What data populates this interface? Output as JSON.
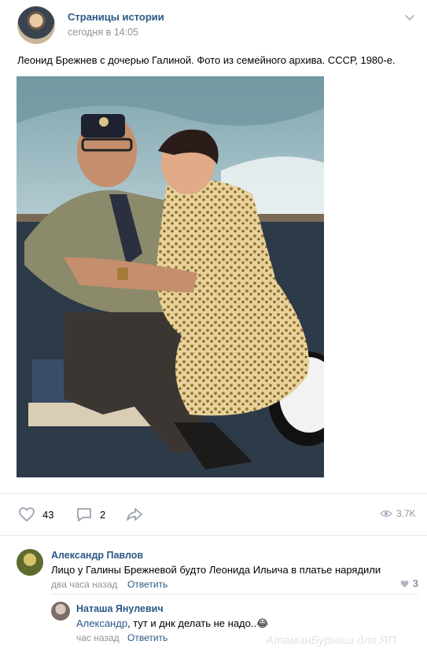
{
  "post": {
    "author": "Страницы истории",
    "date": "сегодня в 14:05",
    "text": "Леонид Брежнев с дочерью Галиной. Фото из семейного архива. СССР, 1980-е.",
    "likes": "43",
    "comments": "2",
    "views": "3.7K"
  },
  "icons": {
    "menu": "chevron-down-icon",
    "like": "heart-icon",
    "comment": "comment-icon",
    "share": "share-arrow-icon",
    "views": "eye-icon",
    "comment_like": "heart-icon"
  },
  "comments": [
    {
      "author": "Александр Павлов",
      "text": "Лицо у Галины Брежневой будто Леонида Ильича в платье нарядили",
      "time": "два часа назад",
      "reply_label": "Ответить",
      "likes": "3"
    },
    {
      "author": "Наташа Янулевич",
      "reply_to": "Александр",
      "text": ", тут и днк делать не надо..",
      "emoji": "😂",
      "time": "час назад",
      "reply_label": "Ответить"
    }
  ],
  "watermark": "АтаманБурнаш для ЯП",
  "colors": {
    "link": "#2a5885",
    "meta": "#939393",
    "divider": "#e7e8ec"
  }
}
